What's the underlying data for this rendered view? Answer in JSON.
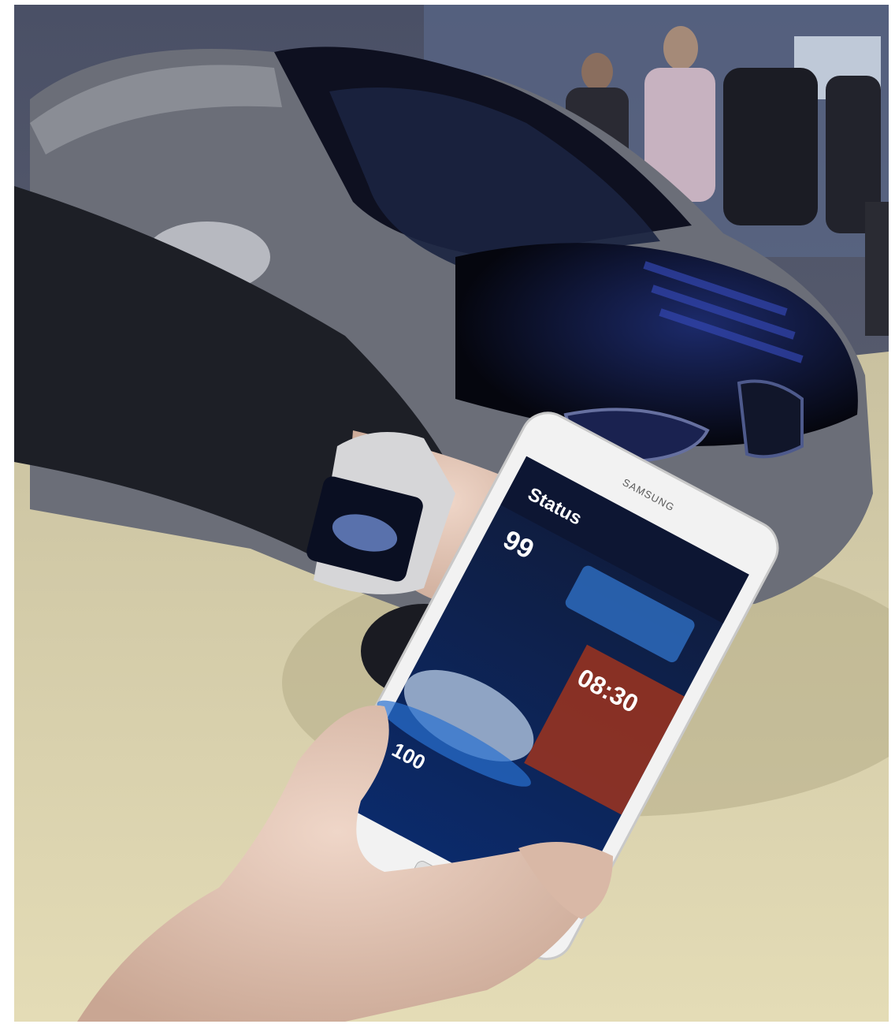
{
  "photo": {
    "phone_brand": "SAMSUNG",
    "phone_app_title": "Status",
    "battery_level": "99",
    "charge_time": "08:30",
    "car_charge": "100"
  },
  "colors": {
    "floor": "#d9cfa6",
    "car_body": "#0b0d1a",
    "car_blue_accent": "#2a3ea8",
    "phone_screen": "#0a1330",
    "phone_frame": "#f4f4f4"
  }
}
